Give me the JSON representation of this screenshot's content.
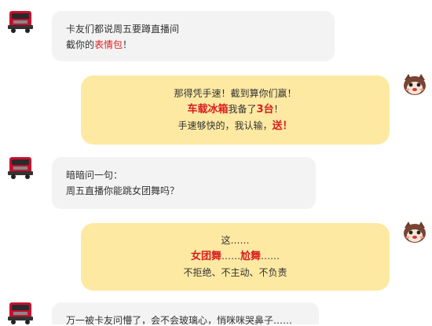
{
  "colors": {
    "gray_bubble": "#f3f3f3",
    "yellow_bubble": "#fde9a2",
    "highlight_red": "#d81e1e",
    "truck_red": "#c8102e"
  },
  "icons": {
    "left_avatar": "red-truck-icon",
    "right_avatar": "cartoon-mascot-icon"
  },
  "messages": [
    {
      "side": "left",
      "line1": "卡友们都说周五要蹲直播间",
      "line2_a": "截你的",
      "line2_b": "表情包",
      "line2_c": "！"
    },
    {
      "side": "right",
      "line1": "那得凭手速！截到算你们赢！",
      "line2_a": "车载冰箱",
      "line2_b": "我备了",
      "line2_c": "3台",
      "line2_d": "！",
      "line3_a": "手速够快的，我认输，",
      "line3_b": "送！"
    },
    {
      "side": "left",
      "line1": "暗暗问一句：",
      "line2": "周五直播你能跳女团舞吗？"
    },
    {
      "side": "right",
      "line1": "这……",
      "line2_a": "女团舞",
      "line2_b": "……",
      "line2_c": "尬舞",
      "line2_d": "……",
      "line3": "不拒绝、不主动、不负责"
    },
    {
      "side": "left",
      "line1": "万一被卡友问懵了，会不会玻璃心，悄咪咪哭鼻子……"
    }
  ]
}
